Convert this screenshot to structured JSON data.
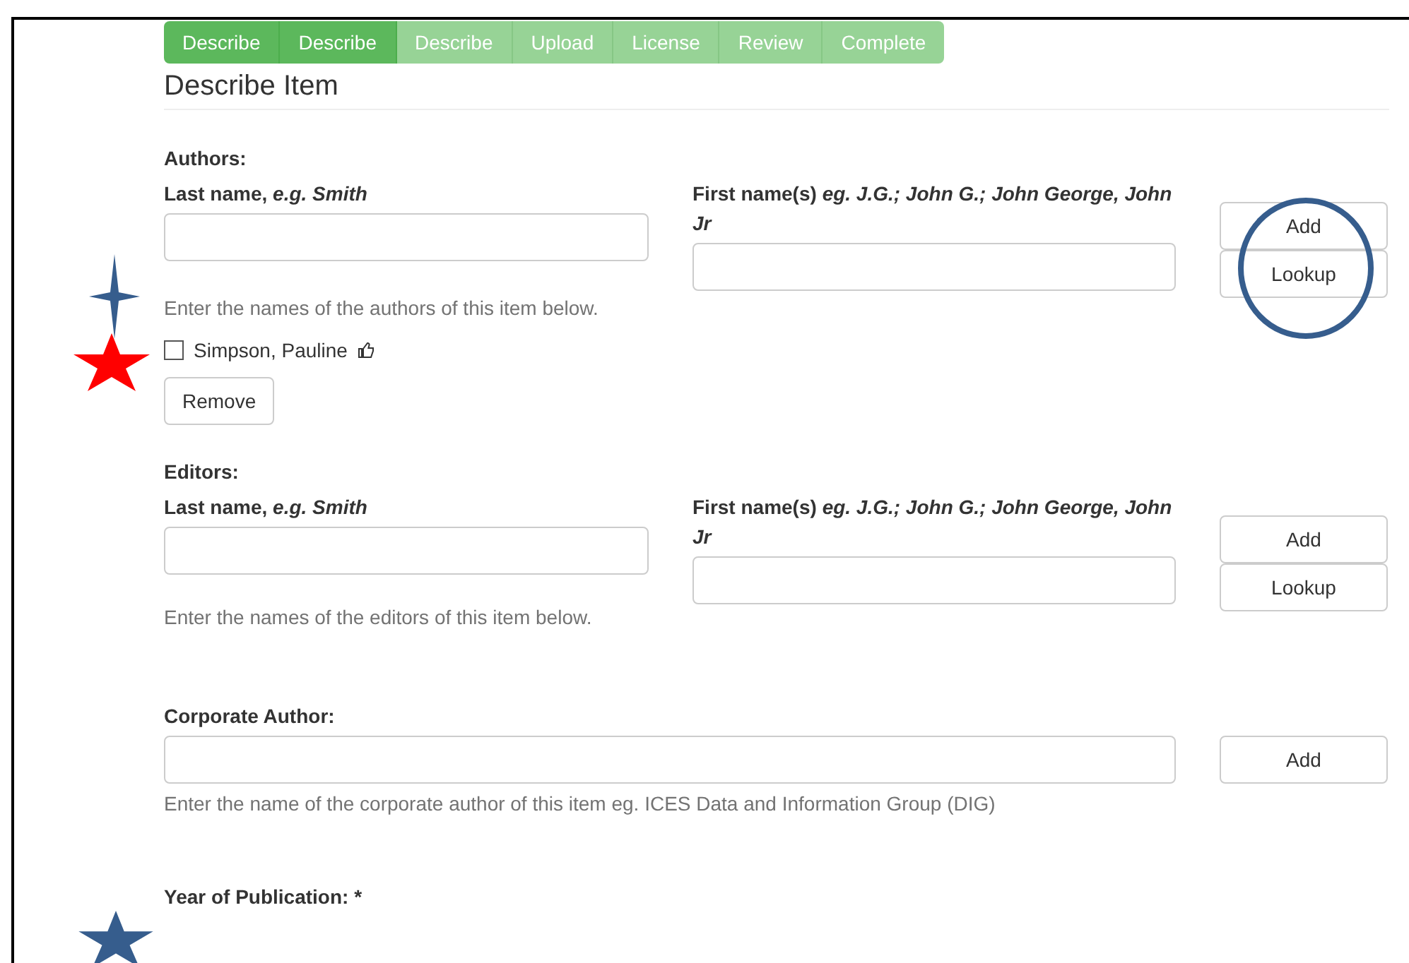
{
  "steps": [
    {
      "label": "Describe",
      "done": true
    },
    {
      "label": "Describe",
      "done": true
    },
    {
      "label": "Describe",
      "done": false
    },
    {
      "label": "Upload",
      "done": false
    },
    {
      "label": "License",
      "done": false
    },
    {
      "label": "Review",
      "done": false
    },
    {
      "label": "Complete",
      "done": false
    }
  ],
  "title": "Describe Item",
  "sections": [
    {
      "kind": "name",
      "label": "Authors:",
      "last_label": "Last name, *e.g. Smith*",
      "first_label": "First name(s) *eg. J.G.; John G.; John George, John Jr*",
      "buttons": [
        "Add",
        "Lookup"
      ],
      "help": "Enter the names of the authors of this item below.",
      "entries": [
        {
          "name": "Simpson, Pauline",
          "checked": false
        }
      ],
      "remove": "Remove"
    },
    {
      "kind": "name",
      "label": "Editors:",
      "last_label": "Last name, *e.g. Smith*",
      "first_label": "First name(s) *eg. J.G.; John G.; John George, John Jr*",
      "buttons": [
        "Add",
        "Lookup"
      ],
      "help": "Enter the names of the editors of this item below."
    },
    {
      "kind": "single",
      "label": "Corporate Author:",
      "buttons": [
        "Add"
      ],
      "help": "Enter the name of the corporate author of this item eg. ICES Data and Information Group (DIG)"
    },
    {
      "kind": "heading",
      "label": "Year of Publication: *"
    }
  ],
  "annotations": [
    {
      "kind": "sparkle",
      "color": "#365d8d"
    },
    {
      "kind": "star",
      "color": "#ff0000"
    },
    {
      "kind": "circle",
      "color": "#365d8d"
    },
    {
      "kind": "star",
      "color": "#365d8d"
    }
  ]
}
